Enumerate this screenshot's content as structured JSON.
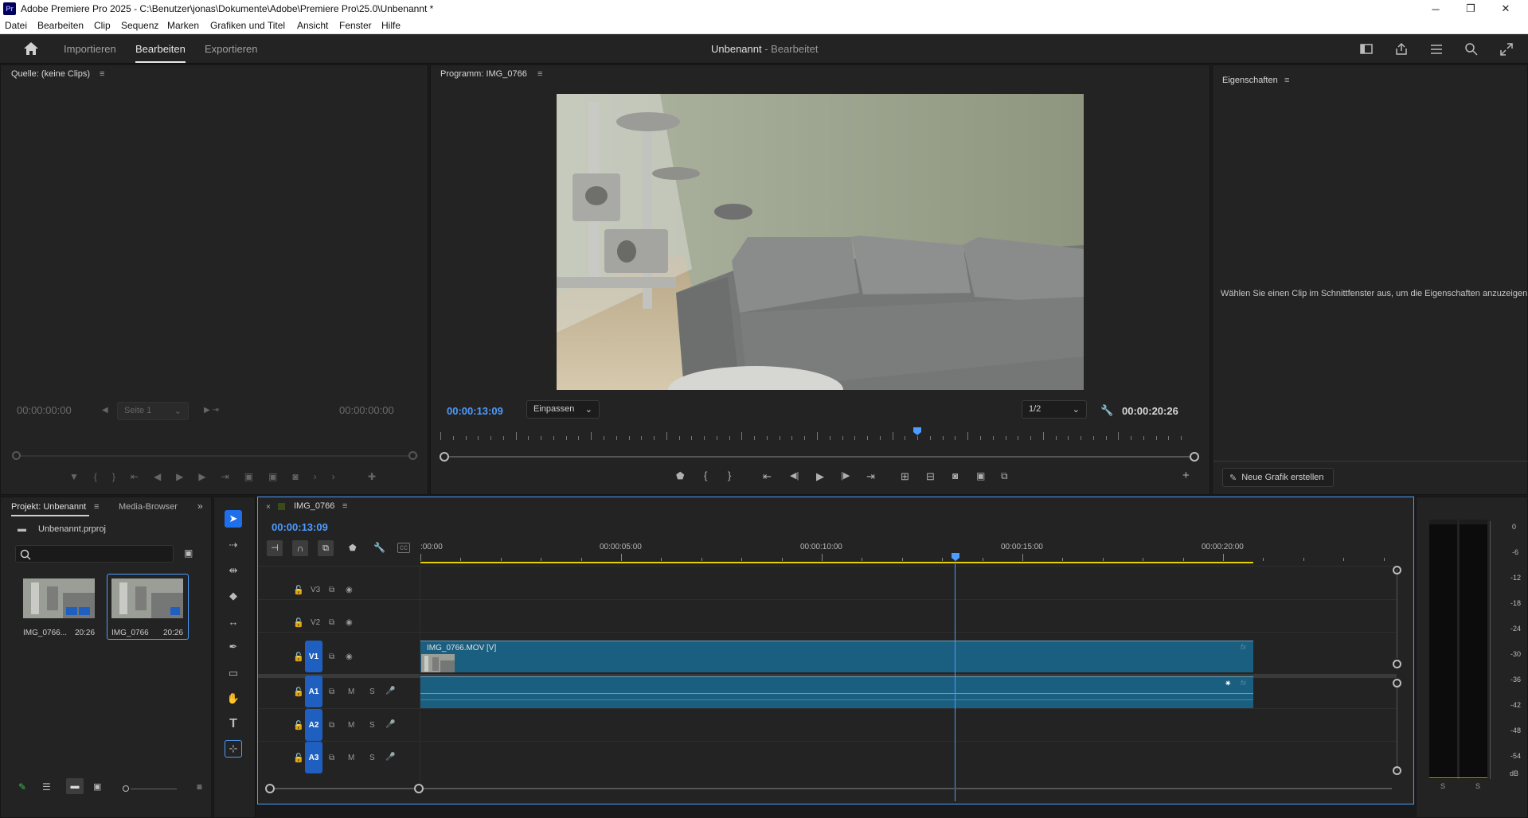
{
  "app": {
    "logo": "Pr",
    "title": "Adobe Premiere Pro 2025 - C:\\Benutzer\\jonas\\Dokumente\\Adobe\\Premiere Pro\\25.0\\Unbenannt *"
  },
  "menu": [
    "Datei",
    "Bearbeiten",
    "Clip",
    "Sequenz",
    "Marken",
    "Grafiken und Titel",
    "Ansicht",
    "Fenster",
    "Hilfe"
  ],
  "workspace": {
    "tabs": [
      "Importieren",
      "Bearbeiten",
      "Exportieren"
    ],
    "active_tab": "Bearbeiten",
    "project_name": "Unbenannt",
    "mode": " - Bearbeitet"
  },
  "source": {
    "title": "Quelle: (keine Clips)",
    "tc_in": "00:00:00:00",
    "tc_out": "00:00:00:00",
    "page": "Seite 1"
  },
  "program": {
    "title": "Programm: IMG_0766",
    "timecode": "00:00:13:09",
    "fit": "Einpassen",
    "resolution": "1/2",
    "duration": "00:00:20:26",
    "playhead_fraction": 0.633
  },
  "properties": {
    "title": "Eigenschaften",
    "message": "Wählen Sie einen Clip im Schnittfenster aus, um die Eigenschaften anzuzeigen.",
    "new_graphic": "Neue Grafik erstellen"
  },
  "project": {
    "tab_active": "Projekt: Unbenannt",
    "tab_media": "Media-Browser",
    "file": "Unbenannt.prproj",
    "items": [
      {
        "name": "IMG_0766...",
        "duration": "20:26"
      },
      {
        "name": "IMG_0766",
        "duration": "20:26"
      }
    ]
  },
  "timeline": {
    "sequence": "IMG_0766",
    "timecode": "00:00:13:09",
    "ruler": [
      ":00:00",
      "00:00:05:00",
      "00:00:10:00",
      "00:00:15:00",
      "00:00:20:00"
    ],
    "video_tracks": [
      "V3",
      "V2",
      "V1"
    ],
    "audio_tracks": [
      "A1",
      "A2",
      "A3"
    ],
    "track_m": "M",
    "track_s": "S",
    "clip_label": "IMG_0766.MOV [V]",
    "fx": "fx"
  },
  "meter": {
    "scale": [
      "0",
      "-6",
      "-12",
      "-18",
      "-24",
      "-30",
      "-36",
      "-42",
      "-48",
      "-54",
      "dB"
    ],
    "solo": [
      "S",
      "S"
    ]
  },
  "colors": {
    "accent": "#4d9cff",
    "clip_video": "#1b5f80",
    "clip_audio": "#1b5f80",
    "track_target": "#1f5fbf",
    "work_area": "#e6d200"
  }
}
